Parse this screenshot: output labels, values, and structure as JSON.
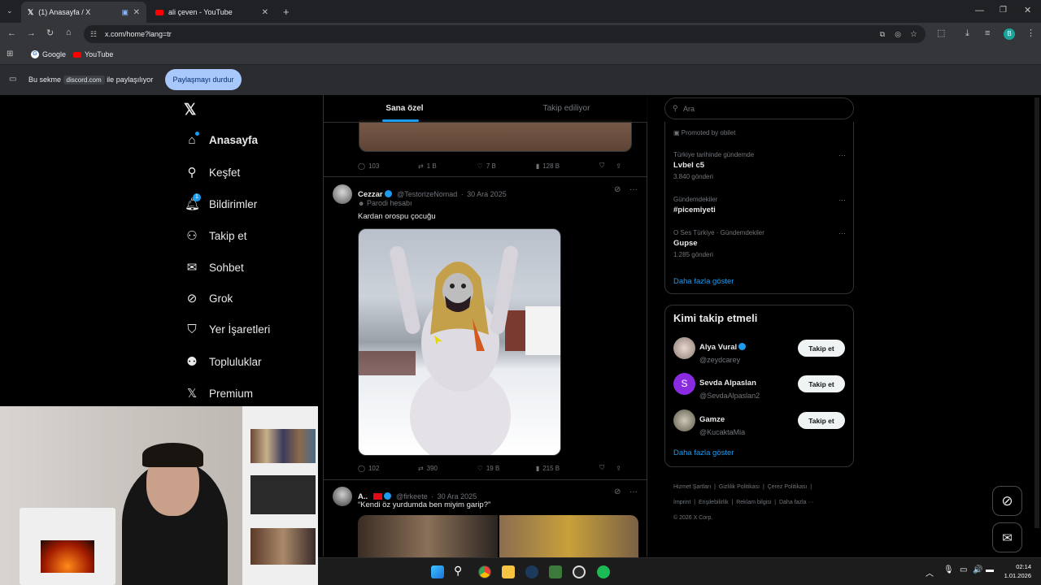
{
  "browser": {
    "tabs": [
      {
        "title": "(1) Anasayfa / X",
        "active": true
      },
      {
        "title": "ali çeven - YouTube",
        "active": false
      }
    ],
    "url": "x.com/home?lang=tr",
    "bookmarks": [
      "Google",
      "YouTube"
    ],
    "share_bar": {
      "prefix": "Bu sekme",
      "site": "discord.com",
      "suffix": "ile paylaşılıyor",
      "stop_label": "Paylaşmayı durdur"
    },
    "profile_initial": "B"
  },
  "x": {
    "nav": [
      {
        "label": "Anasayfa",
        "icon": "home-icon"
      },
      {
        "label": "Keşfet",
        "icon": "search-icon"
      },
      {
        "label": "Bildirimler",
        "icon": "bell-icon",
        "badge": "1"
      },
      {
        "label": "Takip et",
        "icon": "person-add-icon"
      },
      {
        "label": "Sohbet",
        "icon": "mail-icon"
      },
      {
        "label": "Grok",
        "icon": "grok-icon"
      },
      {
        "label": "Yer İşaretleri",
        "icon": "bookmark-icon"
      },
      {
        "label": "Topluluklar",
        "icon": "people-icon"
      },
      {
        "label": "Premium",
        "icon": "x-logo-icon"
      }
    ],
    "feed_tabs": [
      "Sana özel",
      "Takip ediliyor"
    ],
    "tweet1_stats": {
      "replies": "103",
      "reposts": "1 B",
      "likes": "7 B",
      "views": "128 B"
    },
    "tweet2": {
      "name": "Cezzar",
      "handle": "@TestorizeNomad",
      "date": "30 Ara 2025",
      "label": "Parodi hesabı",
      "text": "Kardan orospu çocuğu",
      "stats": {
        "replies": "102",
        "reposts": "390",
        "likes": "19 B",
        "views": "215 B"
      }
    },
    "tweet3": {
      "name": "A..",
      "handle": "@firkeete",
      "date": "30 Ara 2025",
      "text": "“Kendi öz yurdumda ben miyim garip?”"
    },
    "search_placeholder": "Ara",
    "trends": {
      "promoted": "Promoted by obilet",
      "items": [
        {
          "meta": "Türkiye tarihinde gündemde",
          "title": "Lvbel c5",
          "count": "3.840 gönderi"
        },
        {
          "meta": "Gündemdekiler",
          "title": "#picemiyeti",
          "count": ""
        },
        {
          "meta": "O Ses Türkiye · Gündemdekiler",
          "title": "Gupse",
          "count": "1.285 gönderi"
        }
      ],
      "more": "Daha fazla göster"
    },
    "who_to_follow": {
      "title": "Kimi takip etmeli",
      "users": [
        {
          "name": "Alya Vural",
          "handle": "@zeydcarey",
          "verified": true,
          "button": "Takip et"
        },
        {
          "name": "Sevda Alpaslan",
          "handle": "@SevdaAlpaslan2",
          "verified": false,
          "button": "Takip et",
          "initial": "S"
        },
        {
          "name": "Gamze",
          "handle": "@KucaktaMia",
          "verified": false,
          "button": "Takip et"
        }
      ],
      "more": "Daha fazla göster"
    },
    "footer": {
      "links": [
        "Hizmet Şartları",
        "Gizlilik Politikası",
        "Çerez Politikası",
        "İmprint",
        "Erişilebilirlik",
        "Reklam bilgisi",
        "Daha fazla ···"
      ],
      "copyright": "© 2026 X Corp."
    }
  },
  "taskbar": {
    "time": "02:14",
    "date": "1.01.2026"
  },
  "colors": {
    "accent": "#1d9bf0",
    "bg": "#000000",
    "border": "#2f3336",
    "muted": "#71767b"
  }
}
